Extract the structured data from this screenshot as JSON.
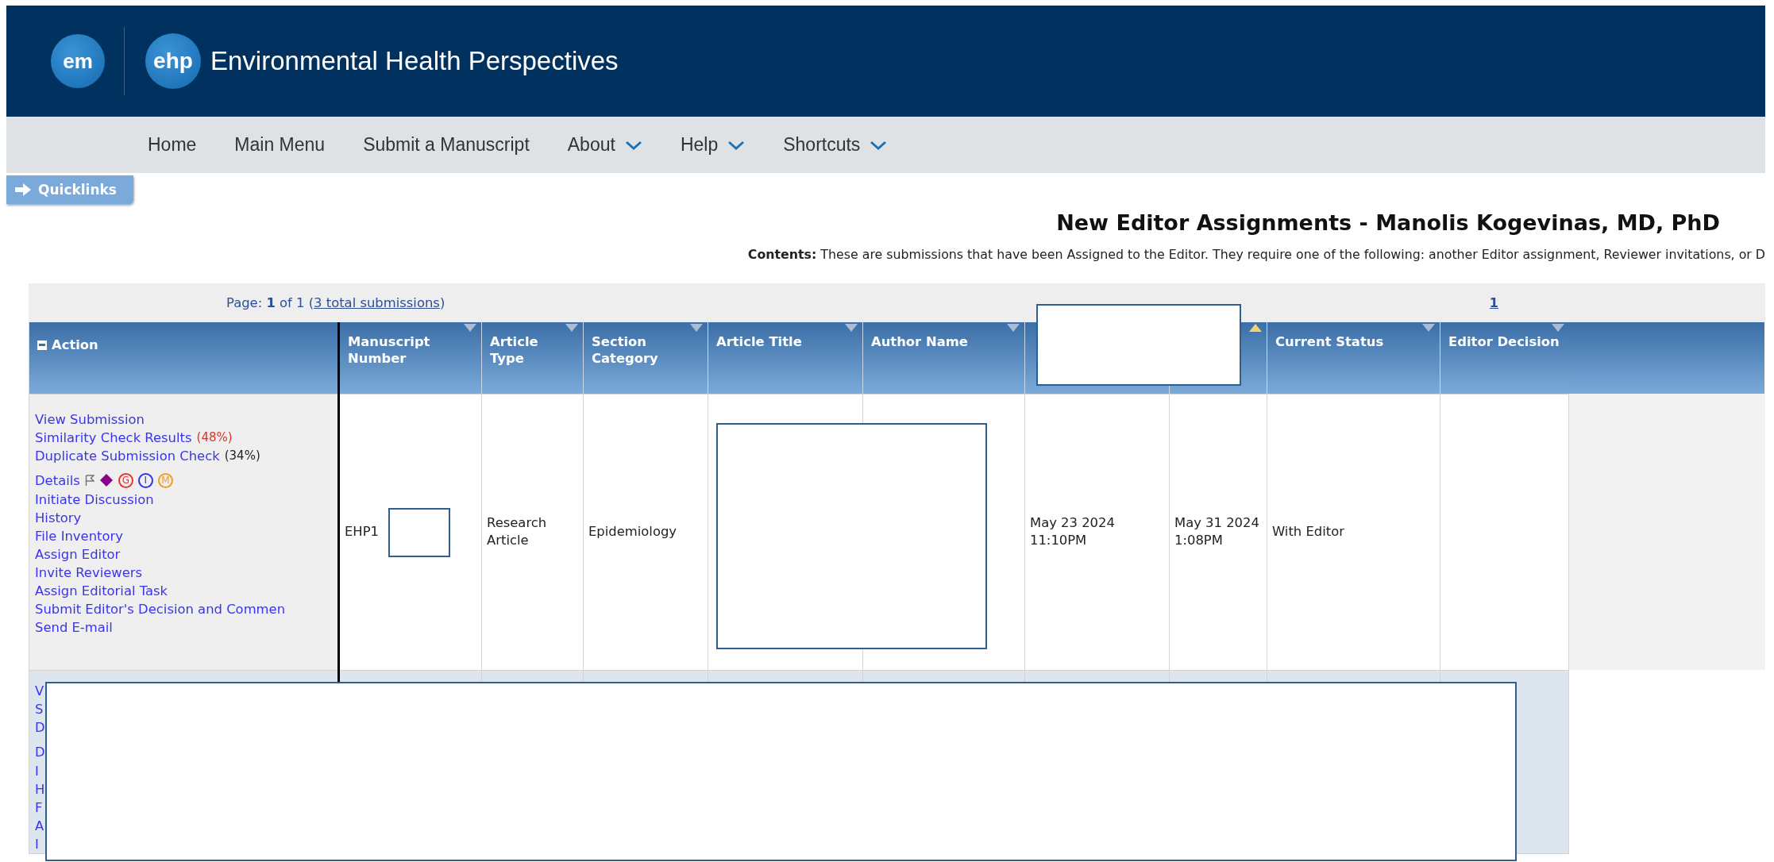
{
  "header": {
    "logos": [
      "em",
      "ehp"
    ],
    "title": "Environmental Health Perspectives"
  },
  "nav": [
    {
      "label": "Home",
      "dropdown": false
    },
    {
      "label": "Main Menu",
      "dropdown": false
    },
    {
      "label": "Submit a Manuscript",
      "dropdown": false
    },
    {
      "label": "About",
      "dropdown": true
    },
    {
      "label": "Help",
      "dropdown": true
    },
    {
      "label": "Shortcuts",
      "dropdown": true
    }
  ],
  "quicklinks": "Quicklinks",
  "page_title": "New Editor Assignments - Manolis Kogevinas, MD, PhD",
  "contents": {
    "label": "Contents:",
    "text": "These are submissions that have been Assigned to the Editor. They require one of the following: another Editor assignment, Reviewer invitations, or D"
  },
  "pager": {
    "text": "Page: **1** of 1 (",
    "link": "3 total submissions",
    "close": ")",
    "pages": [
      "1"
    ]
  },
  "table": {
    "action_column": {
      "label": "Action",
      "expanded": true
    },
    "columns": [
      {
        "label": "Manuscript Number",
        "sorted": false
      },
      {
        "label": "Article Type",
        "sorted": false
      },
      {
        "label": "Section Category",
        "sorted": false
      },
      {
        "label": "Article Title",
        "sorted": false
      },
      {
        "label": "Author Name",
        "sorted": false
      },
      {},
      {
        "sorted": true
      },
      {
        "label": "Current Status",
        "sorted": false
      },
      {
        "label": "Editor Decision",
        "sorted": false
      }
    ],
    "rows": [
      {
        "actions": [
          {
            "label": "View Submission"
          },
          {
            "label": "Similarity Check Results",
            "note": {
              "text": "(48%)",
              "color": "#d9342b"
            }
          },
          {
            "label": "Duplicate Submission Check",
            "note": {
              "text": "(34%)",
              "color": "#222222"
            }
          },
          {
            "label": "Details",
            "kind": "details",
            "badges": [
              {
                "kind": "flag"
              },
              {
                "kind": "diamond",
                "color": "#8b008b"
              },
              {
                "kind": "circle",
                "text": "G",
                "color": "#ee3333"
              },
              {
                "kind": "circle",
                "text": "I",
                "color": "#3333ee"
              },
              {
                "kind": "circle",
                "text": "M",
                "color": "#f59a2a"
              }
            ]
          },
          {
            "label": "Initiate Discussion"
          },
          {
            "label": "History"
          },
          {
            "label": "File Inventory"
          },
          {
            "label": "Assign Editor"
          },
          {
            "label": "Invite Reviewers"
          },
          {
            "label": "Assign Editorial Task"
          },
          {
            "label": "Submit Editor's Decision and Commen"
          },
          {
            "label": "Send E-mail"
          }
        ],
        "cells": [
          "EHP1",
          "Research Article",
          "Epidemiology",
          "",
          "",
          "May 23 2024 11:10PM",
          "May 31 2024 1:08PM",
          "With Editor",
          ""
        ]
      },
      {
        "actions": [
          {
            "label": "V"
          },
          {
            "label": "S"
          },
          {
            "label": "D"
          },
          {
            "label": "D",
            "kind": "details"
          },
          {
            "label": "I"
          },
          {
            "label": "H"
          },
          {
            "label": "F"
          },
          {
            "label": "A"
          },
          {
            "label": "I"
          }
        ],
        "cells": [
          "",
          "",
          "",
          "",
          "",
          "",
          "",
          "",
          ""
        ]
      }
    ]
  }
}
